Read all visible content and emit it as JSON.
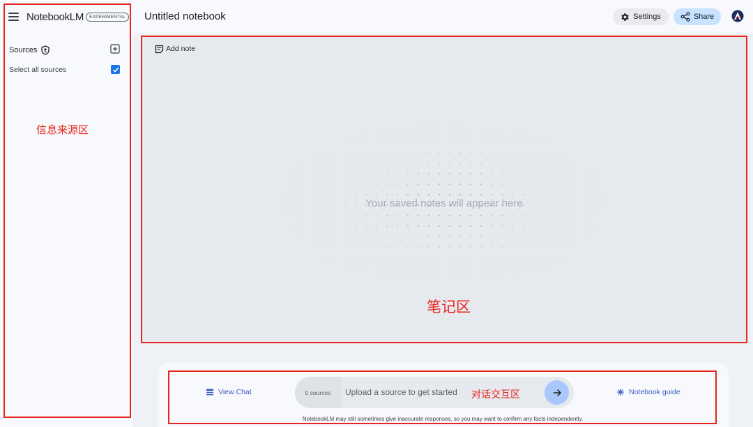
{
  "app": {
    "name": "NotebookLM",
    "badge": "EXPERIMENTAL"
  },
  "sidebar": {
    "sources_label": "Sources",
    "select_all_label": "Select all sources",
    "select_all_checked": true
  },
  "header": {
    "title": "Untitled notebook",
    "settings_label": "Settings",
    "share_label": "Share"
  },
  "notes": {
    "add_note_label": "Add note",
    "empty_message": "Your saved notes will appear here"
  },
  "chat": {
    "view_chat_label": "View Chat",
    "source_count": "0 sources",
    "input_placeholder": "Upload a source to get started",
    "guide_label": "Notebook guide",
    "disclaimer": "NotebookLM may still sometimes give inaccurate responses, so you may want to confirm any facts independently."
  },
  "annotations": {
    "sources_area": "信息来源区",
    "notes_area": "笔记区",
    "chat_area": "对话交互区",
    "color": "#e8241c"
  },
  "colors": {
    "accent_blue": "#1a73e8",
    "share_bg": "#c9e2ff",
    "send_bg": "#a8c7fa",
    "link_blue": "#3b5cc4"
  },
  "icons": [
    "menu-icon",
    "shield-icon",
    "add-box-icon",
    "check-icon",
    "gear-icon",
    "share-icon",
    "avatar-logo",
    "note-icon",
    "chat-icon",
    "arrow-right-icon",
    "sparkle-icon"
  ]
}
